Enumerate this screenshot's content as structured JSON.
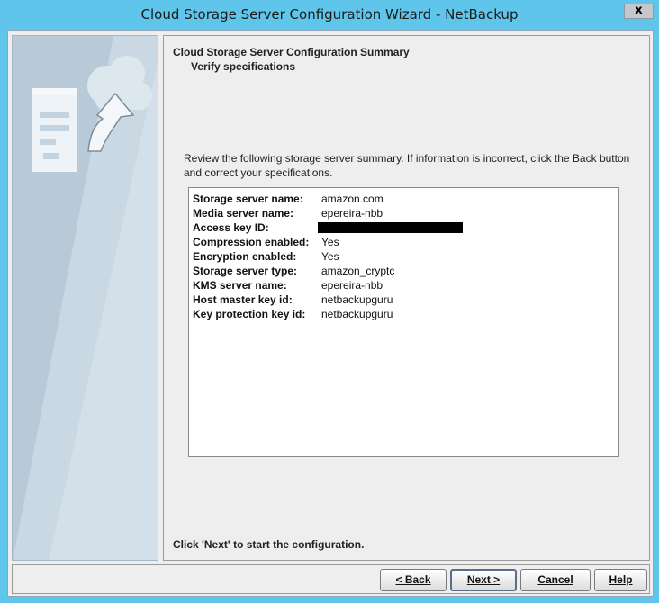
{
  "window": {
    "title": "Cloud Storage Server Configuration Wizard - NetBackup",
    "close_glyph": "x"
  },
  "banner": {
    "icon_names": [
      "server-tower-icon",
      "cloud-icon",
      "curved-arrow-up-icon"
    ]
  },
  "header": {
    "title": "Cloud Storage Server Configuration Summary",
    "subtitle": "Verify specifications"
  },
  "instructions": "Review the following storage server summary.  If information is incorrect, click the Back button and correct your specifications.",
  "summary": {
    "rows": [
      {
        "label": "Storage server name:",
        "value": "amazon.com"
      },
      {
        "label": "Media server name:",
        "value": "epereira-nbb"
      },
      {
        "label": "Access key ID:",
        "value": ""
      },
      {
        "label": "Compression enabled:",
        "value": "Yes"
      },
      {
        "label": "Encryption enabled:",
        "value": "Yes"
      },
      {
        "label": "Storage server type:",
        "value": "amazon_cryptc"
      },
      {
        "label": "KMS server name:",
        "value": "epereira-nbb"
      },
      {
        "label": "Host master key id:",
        "value": "netbackupguru"
      },
      {
        "label": "Key protection key id:",
        "value": "netbackupguru"
      }
    ]
  },
  "footer_note": "Click 'Next' to start the configuration.",
  "buttons": {
    "back": "< Back",
    "next": "Next >",
    "cancel": "Cancel",
    "help": "Help"
  },
  "colors": {
    "titlebar": "#5fc5eb",
    "panel_background": "#eeeeee",
    "banner_background": "#c3d3df",
    "redaction": "#000000"
  }
}
